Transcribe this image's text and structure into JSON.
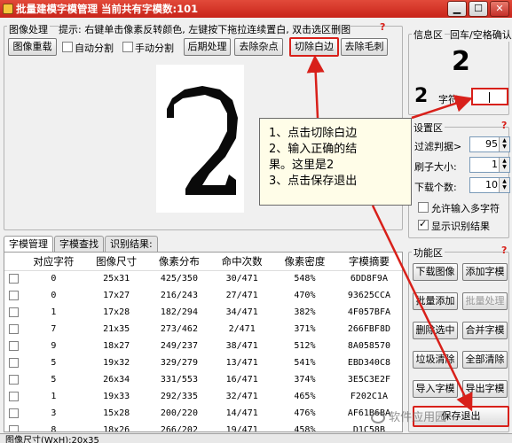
{
  "window": {
    "title": "批量建模字模管理  当前共有字模数:101",
    "min": "▁",
    "max": "☐",
    "close": "✕"
  },
  "image_processing": {
    "label": "图像处理",
    "hint": "提示: 右键单击像素反转颜色, 左键按下拖拉连续置白, 双击选区删图",
    "help": "?",
    "buttons": {
      "reload": "图像重载",
      "auto_split": "自动分割",
      "manual_split": "手动分割",
      "post": "后期处理",
      "denoise": "去除杂点",
      "trim": "切除白边",
      "deburr": "去除毛刺"
    },
    "auto_split_checked": false,
    "manual_split_checked": false
  },
  "info": {
    "label": "信息区",
    "hint": "回车/空格确认",
    "preview_glyph": "2",
    "side_glyph": "2",
    "char_label": "字符:",
    "char_value": "",
    "help": "?"
  },
  "settings": {
    "label": "设置区",
    "filter_label": "过滤判据>",
    "filter_value": "95",
    "brush_label": "刷子大小:",
    "brush_value": "1",
    "download_label": "下载个数:",
    "download_value": "10",
    "allow_multi_label": "允许输入多字符",
    "allow_multi_checked": false,
    "show_result_label": "显示识别结果",
    "show_result_checked": true,
    "help": "?"
  },
  "callout": {
    "line1": "1、点击切除白边",
    "line2": "2、输入正确的结",
    "line3": "果。这里是2",
    "line4": "3、点击保存退出"
  },
  "tabs": [
    "字模管理",
    "字模查找",
    "识别结果:"
  ],
  "table": {
    "headers": [
      "对应字符",
      "图像尺寸",
      "像素分布",
      "命中次数",
      "像素密度",
      "字模摘要"
    ],
    "rows": [
      [
        "0",
        "25x31",
        "425/350",
        "30/471",
        "548%",
        "6DD8F9A"
      ],
      [
        "0",
        "17x27",
        "216/243",
        "27/471",
        "470%",
        "93625CCA"
      ],
      [
        "1",
        "17x28",
        "182/294",
        "34/471",
        "382%",
        "4F057BFA"
      ],
      [
        "7",
        "21x35",
        "273/462",
        "2/471",
        "371%",
        "266FBF8D"
      ],
      [
        "9",
        "18x27",
        "249/237",
        "38/471",
        "512%",
        "8A058570"
      ],
      [
        "5",
        "19x32",
        "329/279",
        "13/471",
        "541%",
        "EBD340C8"
      ],
      [
        "5",
        "26x34",
        "331/553",
        "16/471",
        "374%",
        "3E5C3E2F"
      ],
      [
        "1",
        "19x33",
        "292/335",
        "32/471",
        "465%",
        "F202C1A"
      ],
      [
        "3",
        "15x28",
        "200/220",
        "14/471",
        "476%",
        "AF61B6BA"
      ],
      [
        "8",
        "18x26",
        "266/202",
        "19/471",
        "458%",
        "D1C58B"
      ]
    ]
  },
  "function": {
    "label": "功能区",
    "help": "?",
    "buttons": [
      [
        "下载图像",
        "添加字模"
      ],
      [
        "批量添加",
        "批量处理"
      ],
      [
        "删除选中",
        "合并字模"
      ],
      [
        "垃圾清除",
        "全部清除"
      ],
      [
        "导入字模",
        "导出字模"
      ],
      [
        "保存退出",
        "保存退出"
      ]
    ]
  },
  "status": {
    "text": "图像尺寸(WxH):20x35"
  },
  "watermark": "软件应用园"
}
